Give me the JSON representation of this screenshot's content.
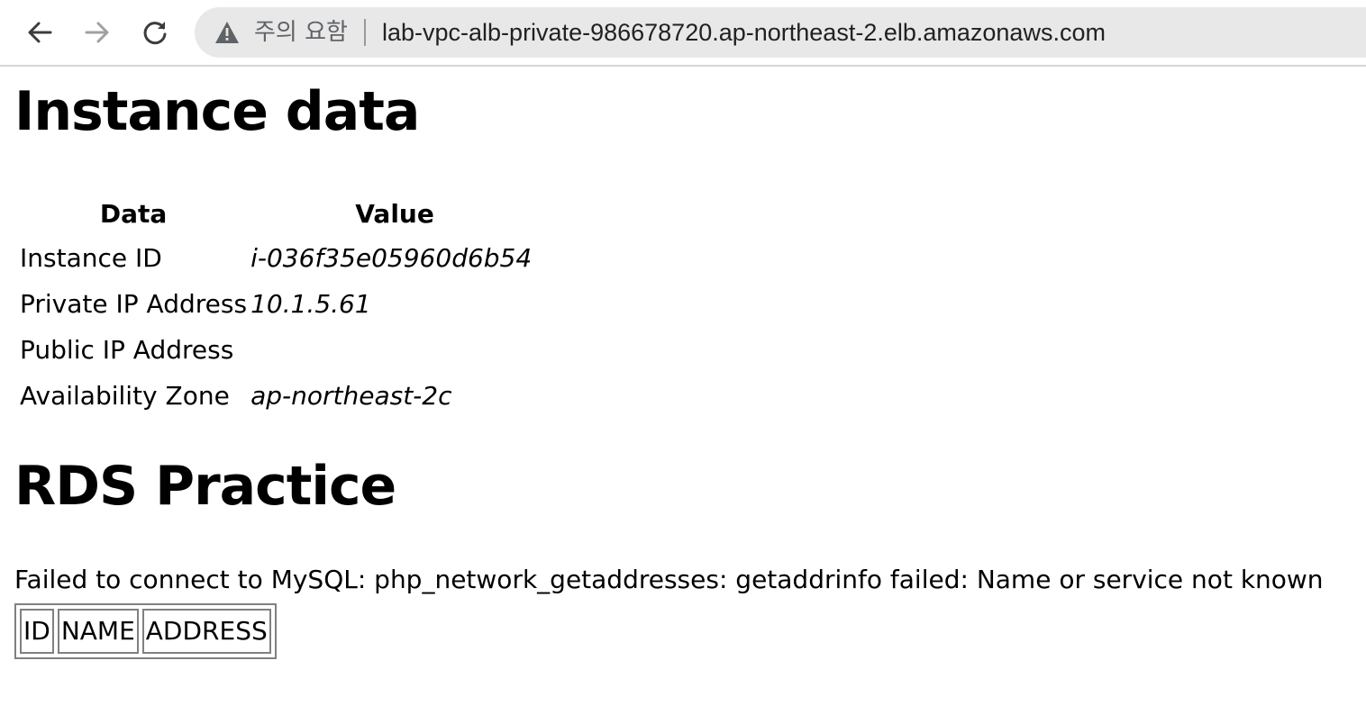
{
  "browser": {
    "back_icon": "arrow-left-icon",
    "forward_icon": "arrow-right-icon",
    "reload_icon": "reload-icon",
    "warning_icon": "warning-triangle-icon",
    "security_label": "주의 요함",
    "url": "lab-vpc-alb-private-986678720.ap-northeast-2.elb.amazonaws.com"
  },
  "instance_section": {
    "title": "Instance data",
    "headers": {
      "data": "Data",
      "value": "Value"
    },
    "rows": [
      {
        "label": "Instance ID",
        "value": "i-036f35e05960d6b54"
      },
      {
        "label": "Private IP Address",
        "value": "10.1.5.61"
      },
      {
        "label": "Public IP Address",
        "value": ""
      },
      {
        "label": "Availability Zone",
        "value": "ap-northeast-2c"
      }
    ]
  },
  "rds_section": {
    "title": "RDS Practice",
    "error_message": "Failed to connect to MySQL: php_network_getaddresses: getaddrinfo failed: Name or service not known",
    "table_headers": [
      "ID",
      "NAME",
      "ADDRESS"
    ]
  }
}
